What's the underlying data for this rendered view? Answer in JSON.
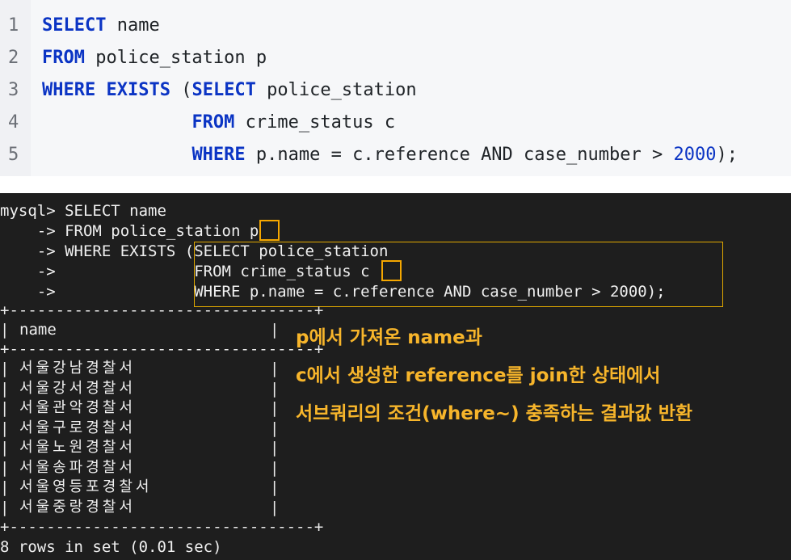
{
  "editor": {
    "lines": [
      {
        "num": "1",
        "parts": [
          {
            "t": "SELECT",
            "k": "kw"
          },
          {
            "t": " name",
            "k": "plain"
          }
        ]
      },
      {
        "num": "2",
        "parts": [
          {
            "t": "FROM",
            "k": "kw"
          },
          {
            "t": " police_station p",
            "k": "plain"
          }
        ]
      },
      {
        "num": "3",
        "parts": [
          {
            "t": "WHERE EXISTS",
            "k": "kw"
          },
          {
            "t": " (",
            "k": "plain"
          },
          {
            "t": "SELECT",
            "k": "kw"
          },
          {
            "t": " police_station",
            "k": "plain"
          }
        ]
      },
      {
        "num": "4",
        "parts": [
          {
            "t": "              ",
            "k": "plain"
          },
          {
            "t": "FROM",
            "k": "kw"
          },
          {
            "t": " crime_status c",
            "k": "plain"
          }
        ]
      },
      {
        "num": "5",
        "parts": [
          {
            "t": "              ",
            "k": "plain"
          },
          {
            "t": "WHERE",
            "k": "kw"
          },
          {
            "t": " p.name = c.reference AND case_number > ",
            "k": "plain"
          },
          {
            "t": "2000",
            "k": "num"
          },
          {
            "t": ");",
            "k": "plain"
          }
        ]
      }
    ]
  },
  "terminal": {
    "prompt_lines": [
      "mysql> SELECT name",
      "    -> FROM police_station p",
      "    -> WHERE EXISTS (SELECT police_station",
      "    ->               FROM crime_status c",
      "    ->               WHERE p.name = c.reference AND case_number > 2000);"
    ],
    "table_border": "+---------------------------------+",
    "column_header": "name",
    "rows": [
      "서울강남경찰서",
      "서울강서경찰서",
      "서울관악경찰서",
      "서울구로경찰서",
      "서울노원경찰서",
      "서울송파경찰서",
      "서울영등포경찰서",
      "서울중랑경찰서"
    ],
    "result_summary": "8 rows in set (0.01 sec)"
  },
  "annotation": {
    "lines": [
      "p에서 가져온 name과",
      "c에서 생성한 reference를 join한 상태에서",
      "서브쿼리의 조건(where~) 충족하는 결과값 반환"
    ],
    "color": "#f7b52b"
  }
}
